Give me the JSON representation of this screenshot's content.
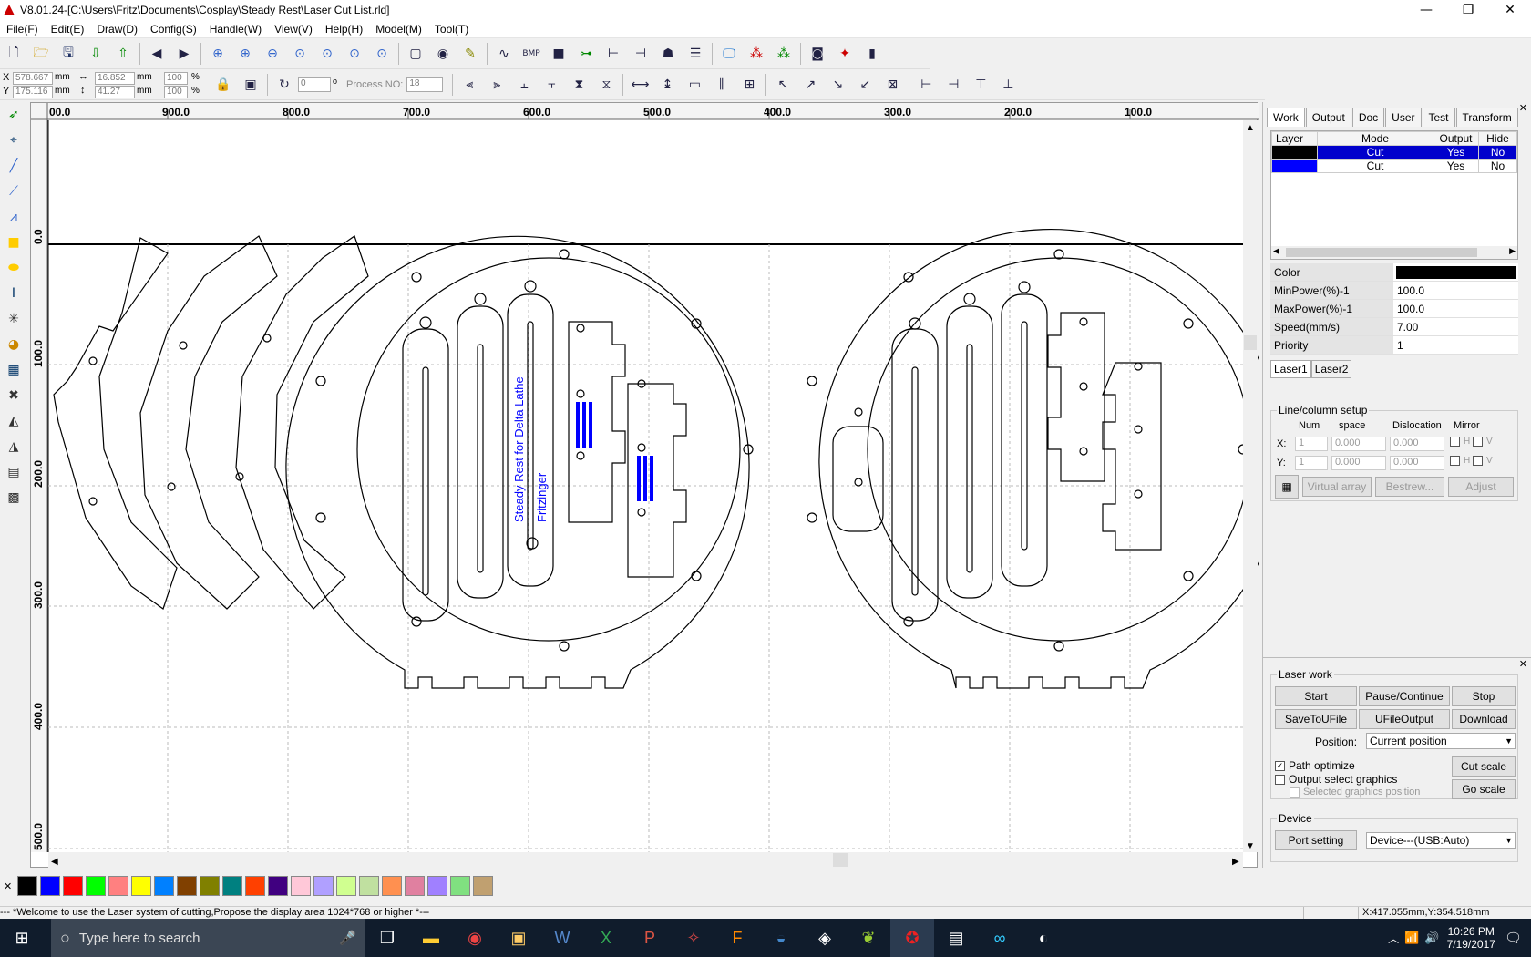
{
  "window": {
    "title": "V8.01.24-[C:\\Users\\Fritz\\Documents\\Cosplay\\Steady Rest\\Laser Cut List.rld]",
    "min_icon": "minimize-icon",
    "max_icon": "restore-icon",
    "close_icon": "close-icon"
  },
  "menu": [
    "File(F)",
    "Edit(E)",
    "Draw(D)",
    "Config(S)",
    "Handle(W)",
    "View(V)",
    "Help(H)",
    "Model(M)",
    "Tool(T)"
  ],
  "coords": {
    "x_label": "X",
    "x_val": "578.667",
    "x_unit": "mm",
    "y_label": "Y",
    "y_val": "175.116",
    "y_unit": "mm",
    "w_val": "16.852",
    "w_unit": "mm",
    "h_val": "41.27",
    "h_unit": "mm",
    "sx": "100",
    "sy": "100",
    "pct": "%",
    "rot": "0",
    "deg": "o",
    "process_label": "Process NO:",
    "process_val": "18"
  },
  "ruler": {
    "top": [
      "00.0",
      "900.0",
      "800.0",
      "700.0",
      "600.0",
      "500.0",
      "400.0",
      "300.0",
      "200.0",
      "100.0"
    ],
    "left": [
      "0.0",
      "100.0",
      "200.0",
      "300.0",
      "400.0",
      "500.0"
    ]
  },
  "engraving": {
    "title": "Steady Rest for Delta Lathe",
    "author": "Fritzinger"
  },
  "panel": {
    "tabs": [
      "Work",
      "Output",
      "Doc",
      "User",
      "Test",
      "Transform"
    ],
    "layer_headers": [
      "Layer",
      "Mode",
      "Output",
      "Hide"
    ],
    "layers": [
      {
        "color": "#000000",
        "mode": "Cut",
        "output": "Yes",
        "hide": "No"
      },
      {
        "color": "#0000ff",
        "mode": "Cut",
        "output": "Yes",
        "hide": "No"
      }
    ],
    "props": [
      {
        "k": "Color",
        "v": ""
      },
      {
        "k": "MinPower(%)-1",
        "v": "100.0"
      },
      {
        "k": "MaxPower(%)-1",
        "v": "100.0"
      },
      {
        "k": "Speed(mm/s)",
        "v": "7.00"
      },
      {
        "k": "Priority",
        "v": "1"
      }
    ],
    "laser_tabs": [
      "Laser1",
      "Laser2"
    ],
    "line_setup": {
      "title": "Line/column setup",
      "headers": [
        "Num",
        "space",
        "Dislocation",
        "Mirror"
      ],
      "x_label": "X:",
      "y_label": "Y:",
      "num": "1",
      "space": "0.000",
      "disloc": "0.000",
      "h": "H",
      "v": "V"
    },
    "array_buttons": [
      "Virtual array",
      "Bestrew...",
      "Adjust"
    ]
  },
  "laserwork": {
    "title": "Laser work",
    "buttons": [
      "Start",
      "Pause/Continue",
      "Stop",
      "SaveToUFile",
      "UFileOutput",
      "Download"
    ],
    "position_label": "Position:",
    "position_value": "Current position",
    "path_optimize": "Path optimize",
    "output_select": "Output select graphics",
    "selected_pos": "Selected graphics position",
    "cut_scale": "Cut scale",
    "go_scale": "Go scale"
  },
  "device": {
    "title": "Device",
    "port_setting": "Port setting",
    "device_value": "Device---(USB:Auto)"
  },
  "palette": [
    "#000000",
    "#0000ff",
    "#ff0000",
    "#00ff00",
    "#ff8080",
    "#ffff00",
    "#0080ff",
    "#804000",
    "#808000",
    "#008080",
    "#ff4000",
    "#400080",
    "#ffc8d8",
    "#b0a0ff",
    "#d0ff90",
    "#c0e0a0",
    "#ff9050",
    "#e080a0",
    "#a080ff",
    "#80e080",
    "#c0a070"
  ],
  "status": {
    "message": "--- *Welcome to use the Laser system of cutting,Propose the display area 1024*768 or higher *---",
    "position": "X:417.055mm,Y:354.518mm"
  },
  "taskbar": {
    "search_placeholder": "Type here to search",
    "time": "10:26 PM",
    "date": "7/19/2017"
  }
}
